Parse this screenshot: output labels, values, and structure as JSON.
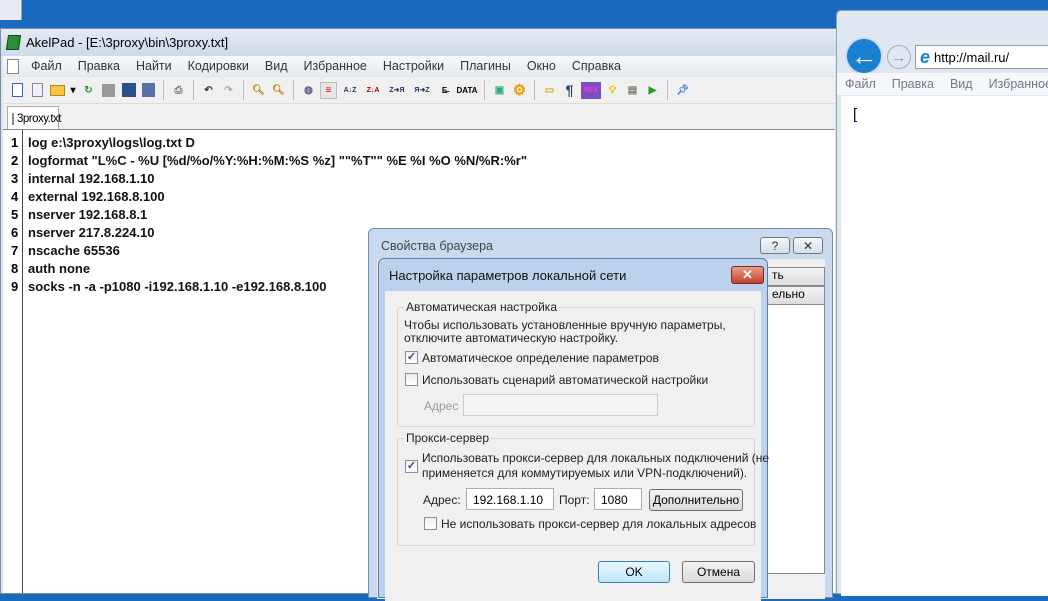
{
  "akelpad": {
    "title": "AkelPad - [E:\\3proxy\\bin\\3proxy.txt]",
    "menu": [
      "Файл",
      "Правка",
      "Найти",
      "Кодировки",
      "Вид",
      "Избранное",
      "Настройки",
      "Плагины",
      "Окно",
      "Справка"
    ],
    "toolbar_text": {
      "az": "A↓Z",
      "za": "Z↓A",
      "z2a": "Z➜Я",
      "a2z": "Я➜Z",
      "data": "DATA",
      "hex": "HEX",
      "pilcrow": "¶"
    },
    "tab": "3proxy.txt",
    "lines": [
      "log e:\\3proxy\\logs\\log.txt D",
      "logformat \"L%C - %U [%d/%o/%Y:%H:%M:%S %z] \"\"%T\"\" %E %I %O %N/%R:%r\"",
      "internal 192.168.1.10",
      "external 192.168.8.100",
      "nserver 192.168.8.1",
      "nserver 217.8.224.10",
      "nscache 65536",
      "auth none",
      "socks -n -a -p1080 -i192.168.1.10 -e192.168.8.100"
    ]
  },
  "ie": {
    "url": "http://mail.ru/",
    "menu": [
      "Файл",
      "Правка",
      "Вид",
      "Избранное"
    ],
    "page_text": "["
  },
  "props": {
    "title": "Свойства браузера",
    "help": "?",
    "close": "✕",
    "bg_btn1": "ть",
    "bg_btn2": "ельно"
  },
  "lan": {
    "title": "Настройка параметров локальной сети",
    "close": "✕",
    "auto_group": "Автоматическая настройка",
    "auto_desc1": "Чтобы использовать установленные вручную параметры,",
    "auto_desc2": "отключите автоматическую настройку.",
    "auto_detect": {
      "label": "Автоматическое определение параметров",
      "checked": true
    },
    "auto_script": {
      "label": "Использовать сценарий автоматической настройки",
      "checked": false
    },
    "script_addr_label": "Адрес",
    "script_addr_value": "",
    "proxy_group": "Прокси-сервер",
    "use_proxy": {
      "label1": "Использовать прокси-сервер для локальных подключений (не",
      "label2": "применяется для коммутируемых или VPN-подключений).",
      "checked": true
    },
    "addr_label": "Адрес:",
    "addr_value": "192.168.1.10",
    "port_label": "Порт:",
    "port_value": "1080",
    "advanced": "Дополнительно",
    "bypass_local": {
      "label": "Не использовать прокси-сервер для локальных адресов",
      "checked": false
    },
    "ok": "OK",
    "cancel": "Отмена"
  }
}
